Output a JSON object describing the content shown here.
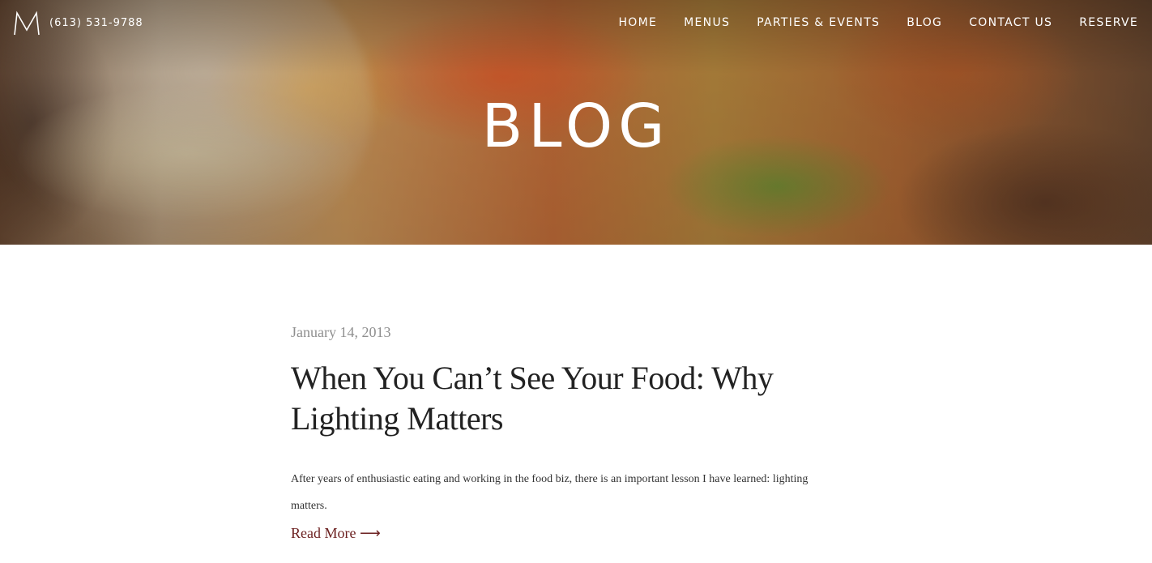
{
  "header": {
    "logo_letter": "M",
    "phone": "(613) 531-9788",
    "nav": [
      {
        "label": "HOME"
      },
      {
        "label": "MENUS"
      },
      {
        "label": "PARTIES & EVENTS"
      },
      {
        "label": "BLOG"
      },
      {
        "label": "CONTACT US"
      },
      {
        "label": "RESERVE"
      }
    ]
  },
  "hero": {
    "title": "BLOG"
  },
  "post": {
    "date": "January 14, 2013",
    "title": "When You Can’t See Your Food: Why Lighting Matters",
    "excerpt": "After years of enthusiastic eating and working in the food biz, there is an important lesson I have learned: lighting matters.",
    "read_more": "Read More ⟶"
  },
  "colors": {
    "title_text": "#222222",
    "date_text": "#8f8f8f",
    "read_more_link": "#6b1f1f",
    "nav_text": "#ffffff"
  }
}
